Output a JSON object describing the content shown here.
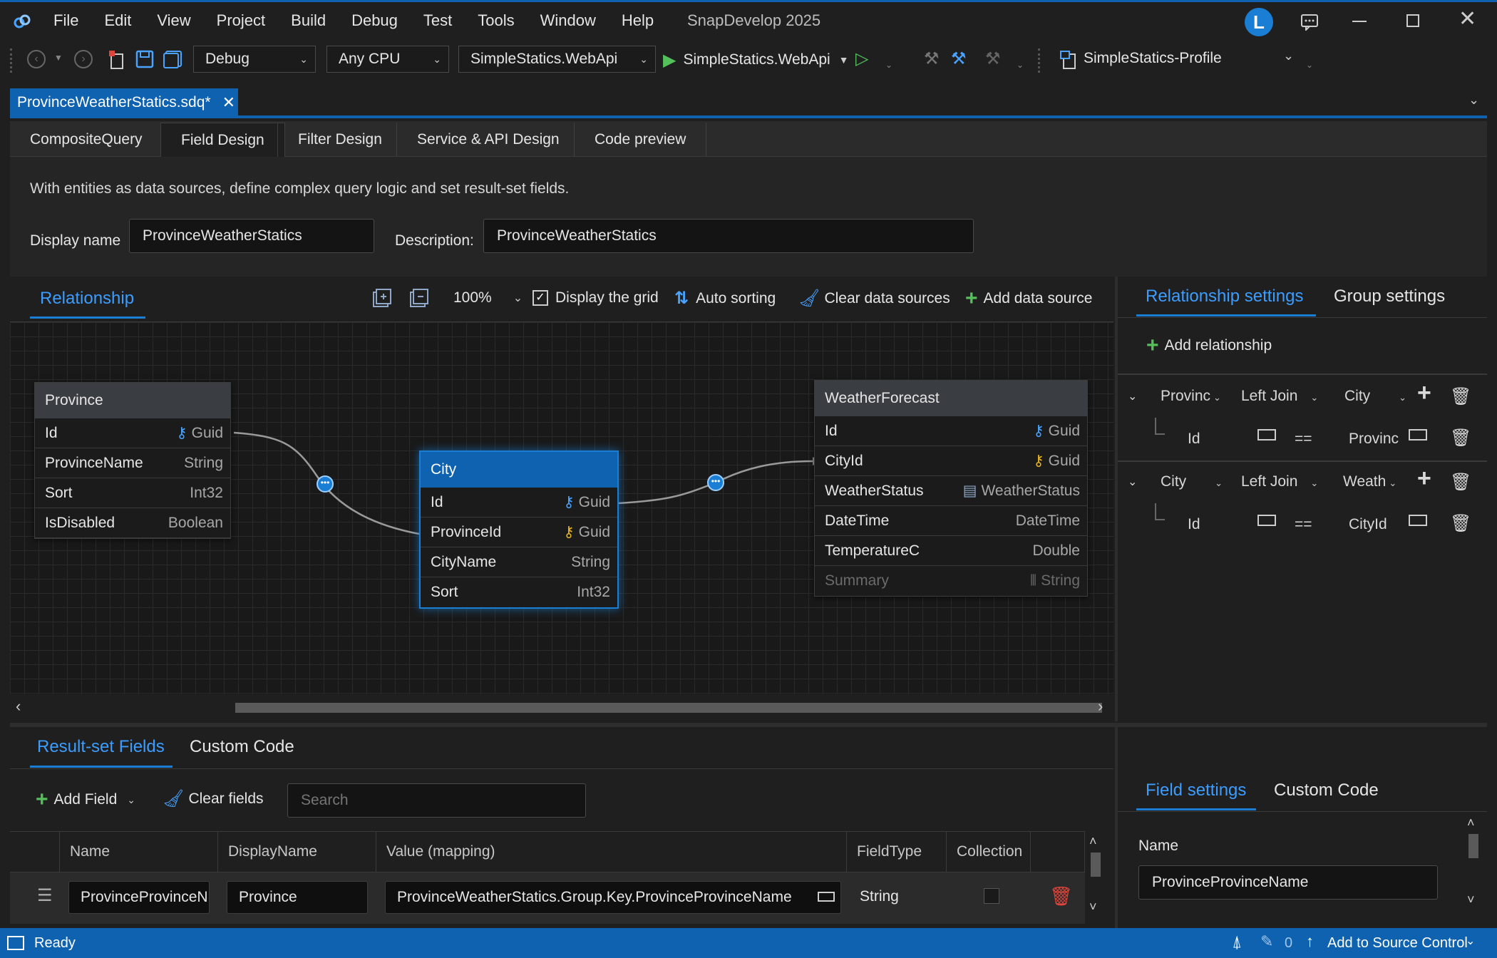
{
  "titlebar": {
    "menu": [
      "File",
      "Edit",
      "View",
      "Project",
      "Build",
      "Debug",
      "Test",
      "Tools",
      "Window",
      "Help"
    ],
    "app_title": "SnapDevelop 2025",
    "avatar_letter": "L"
  },
  "toolbar": {
    "config": "Debug",
    "platform": "Any CPU",
    "project": "SimpleStatics.WebApi",
    "run_label": "SimpleStatics.WebApi",
    "profile": "SimpleStatics-Profile"
  },
  "document_tab": {
    "label": "ProvinceWeatherStatics.sdq*"
  },
  "subtabs": [
    "CompositeQuery",
    "Field Design",
    "Filter Design",
    "Service & API Design",
    "Code preview"
  ],
  "description_text": "With entities as data sources, define complex query logic and set result-set fields.",
  "form": {
    "display_name_label": "Display name",
    "display_name_value": "ProvinceWeatherStatics",
    "description_label": "Description:",
    "description_value": "ProvinceWeatherStatics"
  },
  "relationship": {
    "tab": "Relationship",
    "zoom": "100%",
    "grid_label": "Display the grid",
    "auto_sort": "Auto sorting",
    "clear_sources": "Clear data sources",
    "add_source": "Add data source"
  },
  "entities": {
    "province": {
      "title": "Province",
      "fields": [
        {
          "name": "Id",
          "type": "Guid"
        },
        {
          "name": "ProvinceName",
          "type": "String"
        },
        {
          "name": "Sort",
          "type": "Int32"
        },
        {
          "name": "IsDisabled",
          "type": "Boolean"
        }
      ]
    },
    "city": {
      "title": "City",
      "fields": [
        {
          "name": "Id",
          "type": "Guid"
        },
        {
          "name": "ProvinceId",
          "type": "Guid"
        },
        {
          "name": "CityName",
          "type": "String"
        },
        {
          "name": "Sort",
          "type": "Int32"
        }
      ]
    },
    "weather": {
      "title": "WeatherForecast",
      "fields": [
        {
          "name": "Id",
          "type": "Guid"
        },
        {
          "name": "CityId",
          "type": "Guid"
        },
        {
          "name": "WeatherStatus",
          "type": "WeatherStatus"
        },
        {
          "name": "DateTime",
          "type": "DateTime"
        },
        {
          "name": "TemperatureC",
          "type": "Double"
        },
        {
          "name": "Summary",
          "type": "String"
        }
      ]
    }
  },
  "relationship_settings": {
    "tab": "Relationship settings",
    "group_tab": "Group settings",
    "add": "Add relationship",
    "rows": [
      {
        "left": "Provinc",
        "join": "Left Join",
        "right": "City",
        "left_key": "Id",
        "op": "==",
        "right_key": "Provinc"
      },
      {
        "left": "City",
        "join": "Left Join",
        "right": "Weath",
        "left_key": "Id",
        "op": "==",
        "right_key": "CityId"
      }
    ]
  },
  "result_fields": {
    "tab": "Result-set Fields",
    "custom_tab": "Custom Code",
    "add_field": "Add Field",
    "clear_fields": "Clear fields",
    "search_placeholder": "Search",
    "columns": [
      "Name",
      "DisplayName",
      "Value (mapping)",
      "FieldType",
      "Collection"
    ],
    "rows": [
      {
        "name": "ProvinceProvinceN",
        "display": "Province",
        "value": "ProvinceWeatherStatics.Group.Key.ProvinceProvinceName",
        "type": "String"
      }
    ]
  },
  "field_settings": {
    "tab": "Field settings",
    "custom_tab": "Custom Code",
    "name_label": "Name",
    "name_value": "ProvinceProvinceName"
  },
  "status": {
    "text": "Ready",
    "count": "0",
    "source_control": "Add to Source Control"
  }
}
